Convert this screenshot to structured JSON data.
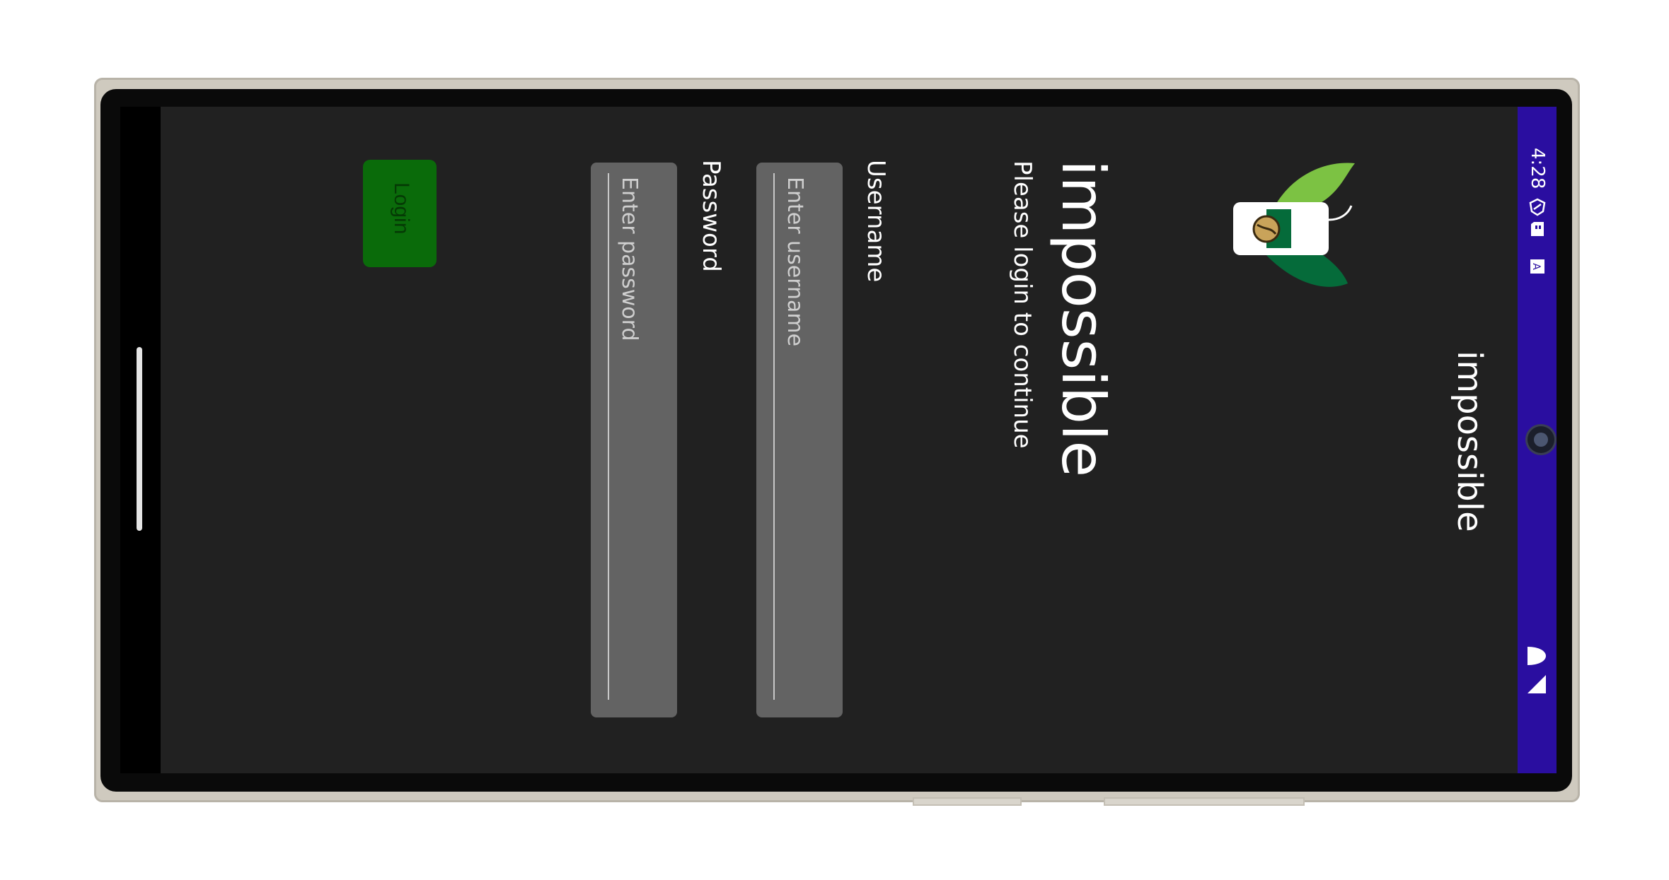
{
  "status_bar": {
    "time": "4:28",
    "icons": [
      "shield-icon",
      "sd-card-icon",
      "a-box-icon",
      "wifi-icon",
      "signal-icon"
    ]
  },
  "app_bar": {
    "title": "impossible"
  },
  "login": {
    "brand_title": "impossible",
    "subtitle": "Please login to continue",
    "username_label": "Username",
    "username_placeholder": "Enter username",
    "username_value": "",
    "password_label": "Password",
    "password_placeholder": "Enter password",
    "password_value": "",
    "login_button": "Login"
  },
  "colors": {
    "status_bar_bg": "#2a0ea0",
    "screen_bg": "#212121",
    "field_bg": "#636363",
    "button_bg": "#0a6b0a",
    "logo_leaf_light": "#7cc243",
    "logo_leaf_dark": "#056b3a"
  }
}
